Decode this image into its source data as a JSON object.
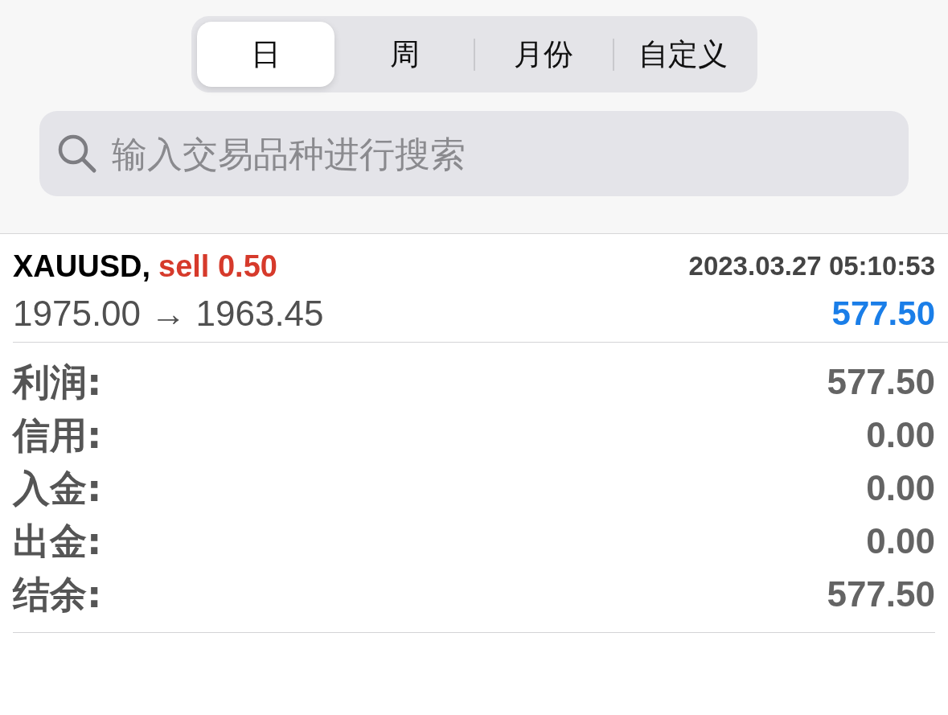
{
  "period_tabs": [
    {
      "label": "日",
      "selected": true
    },
    {
      "label": "周",
      "selected": false
    },
    {
      "label": "月份",
      "selected": false
    },
    {
      "label": "自定义",
      "selected": false
    }
  ],
  "search": {
    "placeholder": "输入交易品种进行搜索"
  },
  "trade": {
    "symbol": "XAUUSD,",
    "order": "sell 0.50",
    "time": "2023.03.27 05:10:53",
    "prices": "1975.00 → 1963.45",
    "profit": "577.50"
  },
  "summary": [
    {
      "label": "利润:",
      "value": "577.50"
    },
    {
      "label": "信用:",
      "value": "0.00"
    },
    {
      "label": "入金:",
      "value": "0.00"
    },
    {
      "label": "出金:",
      "value": "0.00"
    },
    {
      "label": "结余:",
      "value": "577.50"
    }
  ]
}
